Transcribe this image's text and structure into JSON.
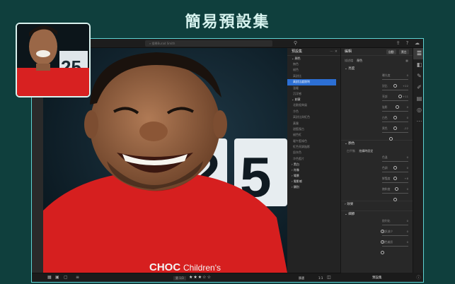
{
  "headline": "簡易預設集",
  "topbar": {
    "search_placeholder": "搜尋Burad Smith",
    "icons": [
      "filter-icon",
      "cloud-sync-icon",
      "help-icon",
      "cloud-icon"
    ]
  },
  "presets_panel": {
    "title": "預設集",
    "group_color": "顏色",
    "color_items": [
      "無色",
      "褪色",
      "高對比",
      "高對比度銳利",
      "溫暖",
      "沉浮感"
    ],
    "selected_index": 3,
    "group_creative": "創意",
    "creative_items": [
      "北歐經典風",
      "冷色",
      "高對比與紅色",
      "黃霧",
      "甜藍復古",
      "褪色紅",
      "暖午藍綠色",
      "紅色亮調陰影",
      "鉛灰色",
      "冷色藍片"
    ],
    "collapsed_groups": [
      "黑白",
      "肖像",
      "場景",
      "電影感",
      "類別"
    ]
  },
  "edit_panel": {
    "title": "編輯",
    "auto_label": "自動",
    "bw_label": "黑白",
    "profile_label": "描述檔",
    "profile_value": "顏色",
    "sec_light": "亮度",
    "light_sliders": [
      {
        "label": "曝光度",
        "value": "0",
        "pos": 0.5
      },
      {
        "label": "對比",
        "value": "+22",
        "pos": 0.68
      },
      {
        "label": "亮部",
        "value": "+11",
        "pos": 0.58
      },
      {
        "label": "陰影",
        "value": "0",
        "pos": 0.5
      },
      {
        "label": "白色",
        "value": "0",
        "pos": 0.5
      },
      {
        "label": "黑色",
        "value": "-22",
        "pos": 0.33
      }
    ],
    "sec_color": "顏色",
    "color_temp_label": "白平衡",
    "color_temp_value": "拍攝時設定",
    "color_sliders": [
      {
        "label": "色溫",
        "value": "0",
        "pos": 0.5
      },
      {
        "label": "色調",
        "value": "0",
        "pos": 0.5
      },
      {
        "label": "鮮豔度",
        "value": "+8",
        "pos": 0.55
      },
      {
        "label": "飽和度",
        "value": "0",
        "pos": 0.5
      }
    ],
    "sec_effects": "效果",
    "sec_optics": "細節",
    "detail_sliders": [
      {
        "label": "銳利化",
        "value": "0",
        "pos": 0.0
      },
      {
        "label": "雜訊減少",
        "value": "0",
        "pos": 0.0
      },
      {
        "label": "顏色雜訊",
        "value": "0",
        "pos": 0.0
      }
    ]
  },
  "right_tools": [
    "sliders-icon",
    "presets-icon",
    "healing-icon",
    "brush-icon",
    "linear-gradient-icon",
    "radial-gradient-icon",
    "more-icon"
  ],
  "bottombar": {
    "counter": "第 1/3",
    "rating_stars": 3,
    "max_stars": 5,
    "sort_label": "排序",
    "filter_label": "篩選",
    "zoom_label": "1:1",
    "presets_button": "預設集"
  },
  "photo": {
    "shirt_text": "CHOC Children's",
    "bg_numbers": "2 5"
  }
}
